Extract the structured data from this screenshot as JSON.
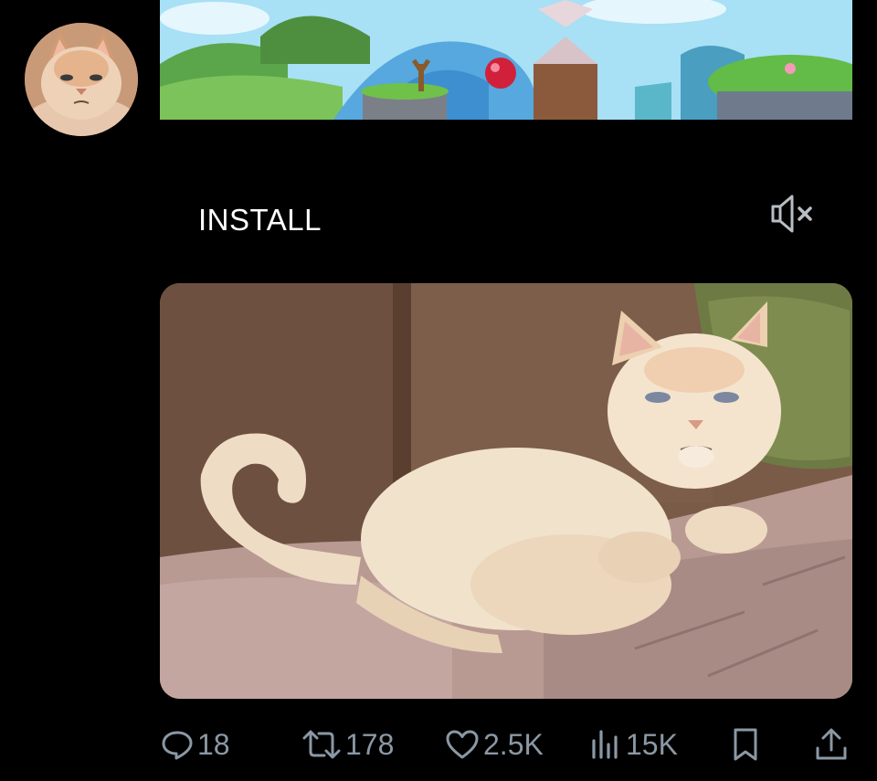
{
  "ad": {
    "install_label": "INSTALL",
    "mute_icon": "speaker-muted-icon"
  },
  "author": {
    "avatar_icon": "cat-avatar"
  },
  "actions": {
    "reply": {
      "icon": "reply-bubble-icon",
      "count": "18"
    },
    "repost": {
      "icon": "repost-arrows-icon",
      "count": "178"
    },
    "like": {
      "icon": "heart-icon",
      "count": "2.5K"
    },
    "views": {
      "icon": "views-bars-icon",
      "count": "15K"
    },
    "bookmark": {
      "icon": "bookmark-icon"
    },
    "share": {
      "icon": "share-upload-icon"
    }
  },
  "colors": {
    "background": "#000000",
    "text": "#ffffff",
    "muted": "#8b98a5"
  }
}
